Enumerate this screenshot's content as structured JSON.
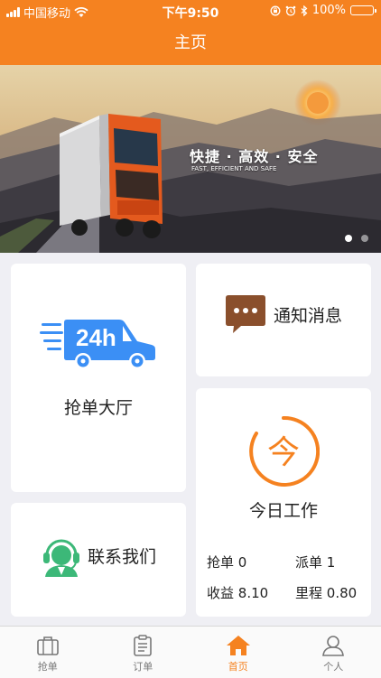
{
  "status_bar": {
    "carrier": "中国移动",
    "time": "下午9:50",
    "battery": "100%",
    "battery_level": 1.0
  },
  "nav": {
    "title": "主页"
  },
  "banner": {
    "title": "快捷 · 高效 · 安全",
    "subtitle": "FAST, EFFICIENT AND SAFE",
    "slide_count": 2,
    "active_slide": 0
  },
  "cards": {
    "hall": {
      "label": "抢单大厅",
      "badge": "24h"
    },
    "notice": {
      "label": "通知消息"
    },
    "today": {
      "label": "今日工作",
      "icon_char": "今",
      "stats": [
        {
          "label": "抢单",
          "value": "0"
        },
        {
          "label": "派单",
          "value": "1"
        },
        {
          "label": "收益",
          "value": "8.10"
        },
        {
          "label": "里程",
          "value": "0.80"
        }
      ]
    },
    "contact": {
      "label": "联系我们"
    }
  },
  "tabbar": {
    "items": [
      {
        "label": "抢单",
        "icon": "briefcase-icon"
      },
      {
        "label": "订单",
        "icon": "clipboard-icon"
      },
      {
        "label": "首页",
        "icon": "home-icon"
      },
      {
        "label": "个人",
        "icon": "person-icon"
      }
    ],
    "active_index": 2
  },
  "colors": {
    "accent": "#f58220",
    "hall_icon": "#3b8ff5",
    "notice_icon": "#8a4f2c",
    "contact_icon": "#3cb878"
  }
}
